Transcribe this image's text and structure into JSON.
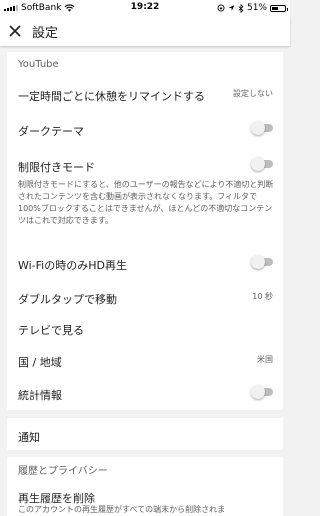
{
  "status_bar": {
    "carrier": "SoftBank",
    "time": "19:22",
    "battery": "51%",
    "battery_level": 0.51
  },
  "app_bar": {
    "title": "設定",
    "close_icon": "close-icon"
  },
  "youtube_section": {
    "header": "YouTube",
    "remind_break": {
      "label": "一定時間ごとに休憩をリマインドする",
      "value": "設定しない"
    },
    "dark_theme": {
      "label": "ダークテーマ",
      "on": false
    },
    "restricted_mode": {
      "label": "制限付きモード",
      "on": false,
      "description": "制限付きモードにすると、他のユーザーの報告などにより不適切と判断されたコンテンツを含む動画が表示されなくなります。フィルタで100%ブロックすることはできませんが、ほとんどの不適切なコンテンツはこれで対応できます。"
    },
    "wifi_hd": {
      "label": "Wi-Fiの時のみHD再生",
      "on": false
    },
    "double_tap": {
      "label": "ダブルタップで移動",
      "value": "10 秒"
    },
    "tv": {
      "label": "テレビで見る"
    },
    "country": {
      "label": "国 / 地域",
      "value": "米国"
    },
    "stats": {
      "label": "統計情報",
      "on": false
    }
  },
  "notifications": {
    "label": "通知"
  },
  "history_section": {
    "header": "履歴とプライバシー",
    "clear_history": {
      "label": "再生履歴を削除",
      "description": "このアカウントの再生履歴がすべての端末から削除されま"
    }
  }
}
